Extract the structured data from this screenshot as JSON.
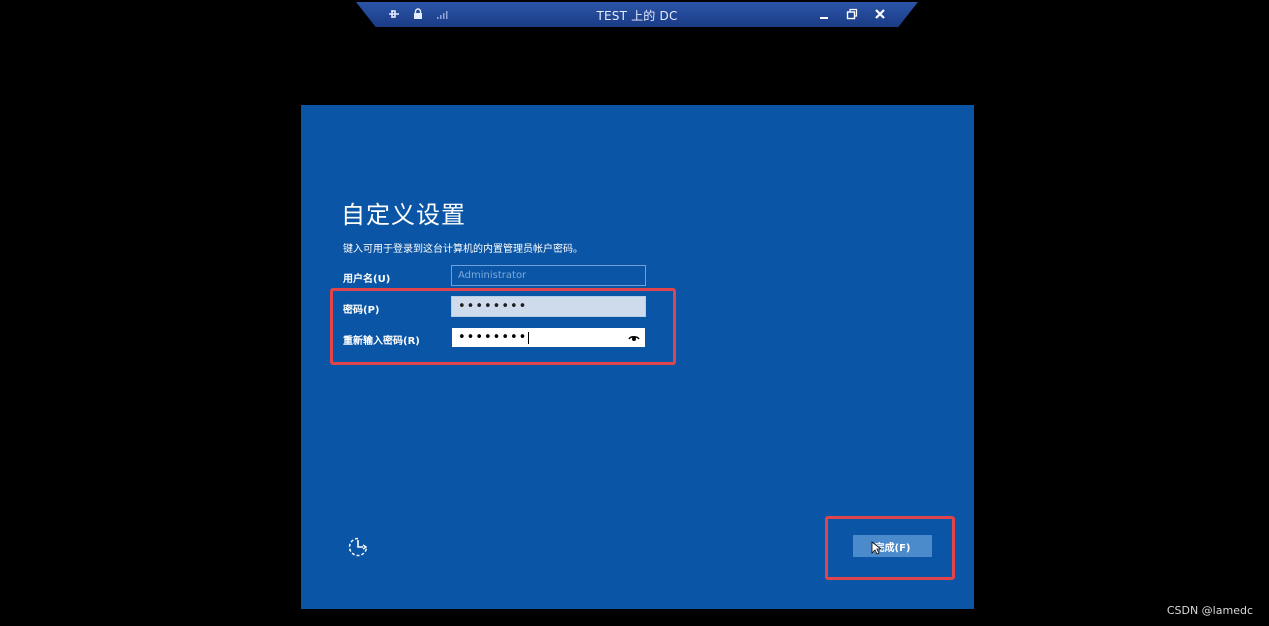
{
  "connection_bar": {
    "title": "TEST 上的 DC",
    "left_icons": [
      "pin-icon",
      "lock-icon",
      "signal-icon"
    ],
    "right_icons": [
      "minimize-icon",
      "restore-icon",
      "close-icon"
    ]
  },
  "setup": {
    "heading": "自定义设置",
    "subtitle": "键入可用于登录到这台计算机的内置管理员帐户密码。",
    "username_label": "用户名(U)",
    "username_value": "Administrator",
    "password_label": "密码(P)",
    "password_value": "••••••••",
    "confirm_label": "重新输入密码(R)",
    "confirm_value": "••••••••",
    "finish_label": "完成(F)"
  },
  "colors": {
    "screen_bg": "#0a55a5",
    "annotation": "#e0454b",
    "button_bg": "#4c8bcb"
  },
  "watermark": "CSDN @lamedc"
}
